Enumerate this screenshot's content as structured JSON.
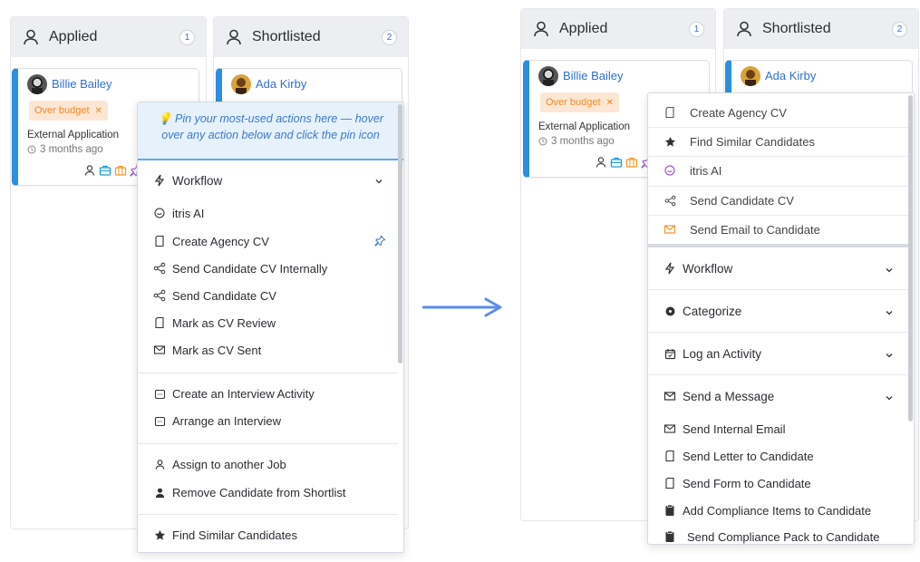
{
  "left": {
    "columns": [
      {
        "title": "Applied",
        "count": "1"
      },
      {
        "title": "Shortlisted",
        "count": "2"
      }
    ],
    "cards": [
      {
        "name": "Billie Bailey",
        "tag": "Over budget",
        "source": "External Application",
        "ago": "3 months ago"
      },
      {
        "name": "Ada Kirby"
      }
    ],
    "menu": {
      "hint_line1": "Pin your most-used actions here — hover",
      "hint_line2": "over any action below and click the pin icon",
      "group": "Workflow",
      "items_a": [
        "itris AI",
        "Create Agency CV",
        "Send Candidate CV Internally",
        "Send Candidate CV",
        "Mark as CV Review",
        "Mark as CV Sent"
      ],
      "items_b": [
        "Create an Interview Activity",
        "Arrange an Interview"
      ],
      "items_c": [
        "Assign to another Job",
        "Remove Candidate from Shortlist"
      ],
      "items_d": [
        "Find Similar Candidates"
      ]
    }
  },
  "right": {
    "columns": [
      {
        "title": "Applied",
        "count": "1"
      },
      {
        "title": "Shortlisted",
        "count": "2"
      }
    ],
    "cards": [
      {
        "name": "Billie Bailey",
        "tag": "Over budget",
        "source": "External Application",
        "ago": "3 months ago"
      },
      {
        "name": "Ada Kirby"
      }
    ],
    "menu": {
      "pinned": [
        "Create Agency CV",
        "Find Similar Candidates",
        "itris AI",
        "Send Candidate CV",
        "Send Email to Candidate"
      ],
      "groups": [
        "Workflow",
        "Categorize",
        "Log an Activity",
        "Send a Message"
      ],
      "message_items": [
        "Send Internal Email",
        "Send Letter to Candidate",
        "Send Form to Candidate",
        "Add Compliance Items to Candidate",
        "Send Compliance Pack to Candidate"
      ]
    }
  },
  "colors": {
    "accent": "#2d8fdd",
    "link": "#2f6fd3",
    "tag_bg": "#fde7d4",
    "tag_fg": "#ee8a2a",
    "arrow": "#5b8de8"
  }
}
